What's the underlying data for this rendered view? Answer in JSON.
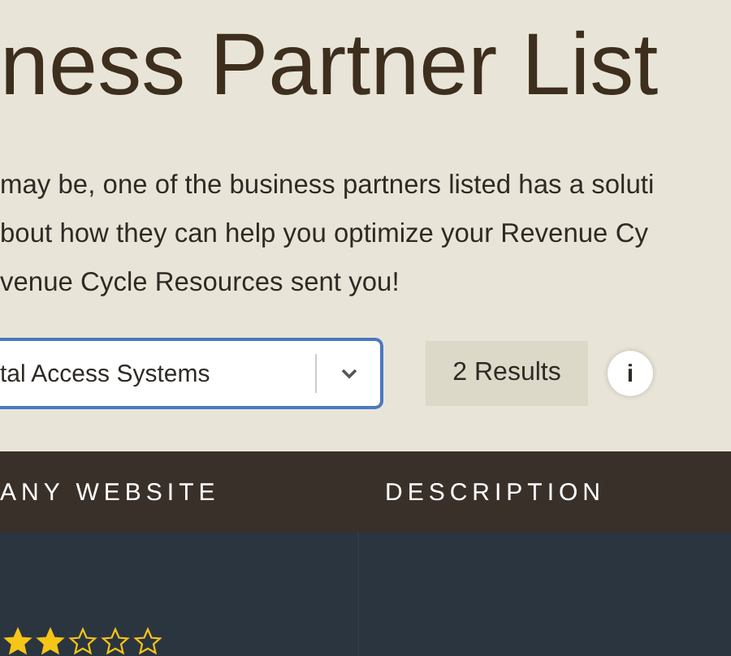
{
  "heading": "ness Partner List",
  "intro_lines": [
    "may be, one of the business partners listed has a soluti",
    "bout how they can help you optimize your Revenue Cy",
    "venue Cycle Resources sent you!"
  ],
  "filter": {
    "value": "tal Access Systems"
  },
  "results": "2 Results",
  "info": "i",
  "table": {
    "columns": [
      "ANY WEBSITE",
      "DESCRIPTION"
    ],
    "rows": [
      {
        "stars": 2
      }
    ]
  }
}
